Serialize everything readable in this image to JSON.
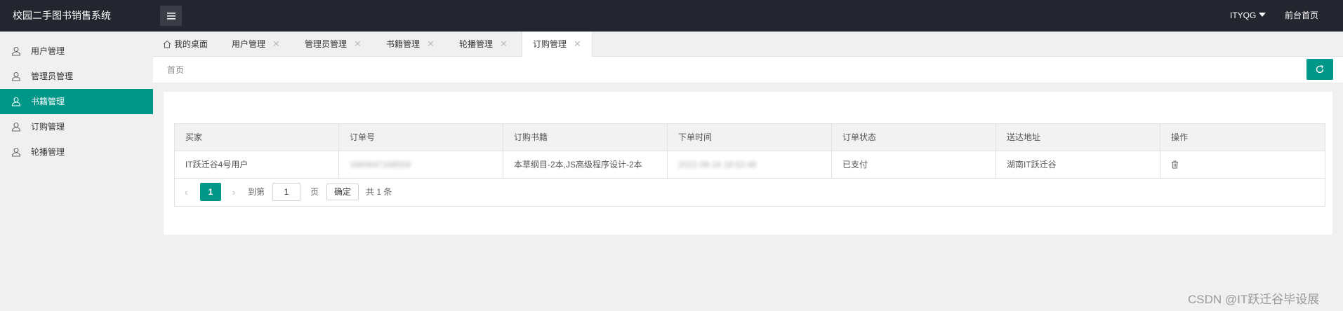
{
  "app": {
    "title": "校园二手图书销售系统",
    "user": "ITYQG",
    "front_link": "前台首页"
  },
  "sidebar": {
    "items": [
      {
        "label": "用户管理",
        "icon": "user-icon"
      },
      {
        "label": "管理员管理",
        "icon": "user-icon"
      },
      {
        "label": "书籍管理",
        "icon": "user-icon",
        "active": true
      },
      {
        "label": "订购管理",
        "icon": "user-icon"
      },
      {
        "label": "轮播管理",
        "icon": "user-icon"
      }
    ]
  },
  "tabs": [
    {
      "label": "我的桌面",
      "icon": "home-icon"
    },
    {
      "label": "用户管理",
      "close": "✕"
    },
    {
      "label": "管理员管理",
      "close": "✕"
    },
    {
      "label": "书籍管理",
      "close": "✕"
    },
    {
      "label": "轮播管理",
      "close": "✕"
    },
    {
      "label": "订购管理",
      "close": "✕",
      "active": true
    }
  ],
  "breadcrumb": "首页",
  "table": {
    "headers": [
      "买家",
      "订单号",
      "订购书籍",
      "下单时间",
      "订单状态",
      "送达地址",
      "操作"
    ],
    "rows": [
      {
        "buyer": "IT跃迁谷4号用户",
        "order_no": "1660647168559",
        "books": "本草纲目-2本,JS高级程序设计-2本",
        "time": "2022-08-16 18:52:48",
        "status": "已支付",
        "address": "湖南IT跃迁谷",
        "action_icon": "trash-icon"
      }
    ]
  },
  "pager": {
    "prev": "‹",
    "current": "1",
    "next": "›",
    "goto_label": "到第",
    "page_value": "1",
    "page_unit": "页",
    "confirm": "确定",
    "total": "共 1 条"
  },
  "watermark": "CSDN @IT跃迁谷毕设展",
  "colors": {
    "accent": "#009688",
    "topbar": "#23262e"
  }
}
